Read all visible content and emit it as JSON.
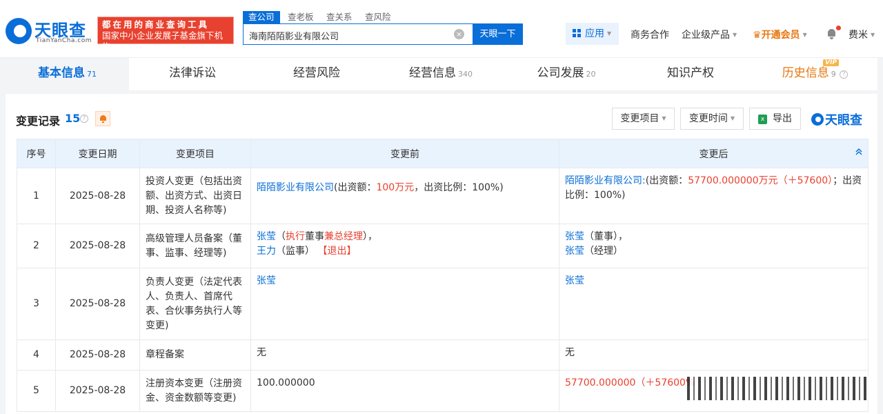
{
  "header": {
    "logo_cn": "天眼查",
    "logo_en": "TianYanCha.com",
    "slogan_line1": "都在用的商业查询工具",
    "slogan_line2": "国家中小企业发展子基金旗下机构",
    "search_tabs": [
      "查公司",
      "查老板",
      "查关系",
      "查风险"
    ],
    "search_value": "海南陌陌影业有限公司",
    "search_button": "天眼一下",
    "apps_label": "应用",
    "nav_business": "商务合作",
    "nav_enterprise": "企业级产品",
    "nav_vip": "开通会员",
    "user_name": "费米"
  },
  "main_tabs": [
    {
      "label": "基本信息",
      "count": "71"
    },
    {
      "label": "法律诉讼",
      "count": ""
    },
    {
      "label": "经营风险",
      "count": ""
    },
    {
      "label": "经营信息",
      "count": "340"
    },
    {
      "label": "公司发展",
      "count": "20"
    },
    {
      "label": "知识产权",
      "count": ""
    },
    {
      "label": "历史信息",
      "count": "9"
    }
  ],
  "vip_tag": "VIP",
  "section": {
    "title": "变更记录",
    "count": "15",
    "filter_item": "变更项目",
    "filter_time": "变更时间",
    "export": "导出",
    "brand": "天眼查"
  },
  "table": {
    "headers": [
      "序号",
      "变更日期",
      "变更项目",
      "变更前",
      "变更后"
    ],
    "rows": [
      {
        "no": "1",
        "date": "2025-08-28",
        "item": "投资人变更（包括出资额、出资方式、出资日期、投资人名称等)"
      },
      {
        "no": "2",
        "date": "2025-08-28",
        "item": "高级管理人员备案（董事、监事、经理等)"
      },
      {
        "no": "3",
        "date": "2025-08-28",
        "item": "负责人变更（法定代表人、负责人、首席代表、合伙事务执行人等变更)"
      },
      {
        "no": "4",
        "date": "2025-08-28",
        "item": "章程备案"
      },
      {
        "no": "5",
        "date": "2025-08-28",
        "item": "注册资本变更（注册资金、资金数额等变更)"
      }
    ],
    "r1_before": {
      "company": "陌陌影业有限公司",
      "p1": "(出资额：",
      "amount": "100万元",
      "p2": "，出资比例：100%)"
    },
    "r1_after": {
      "company": "陌陌影业有限公司:",
      "p1": "(出资额：",
      "amount": "57700.000000万元（＋57600）",
      "p2": "；出资比例：100%)"
    },
    "r2_before": {
      "name1": "张莹",
      "open1": "（",
      "role1a": "执行",
      "role1b": "董事",
      "role1c": "兼总经理",
      "close1": "），",
      "name2": "王力",
      "role2": "（监事）",
      "tag": "【退出】"
    },
    "r2_after": {
      "name1": "张莹",
      "role1": "（董事），",
      "name2": "张莹",
      "role2": "（经理）"
    },
    "r3_before": "张莹",
    "r3_after": "张莹",
    "r4_before": "无",
    "r4_after": "无",
    "r5_before": "100.000000",
    "r5_after": "57700.000000（＋57600%"
  }
}
